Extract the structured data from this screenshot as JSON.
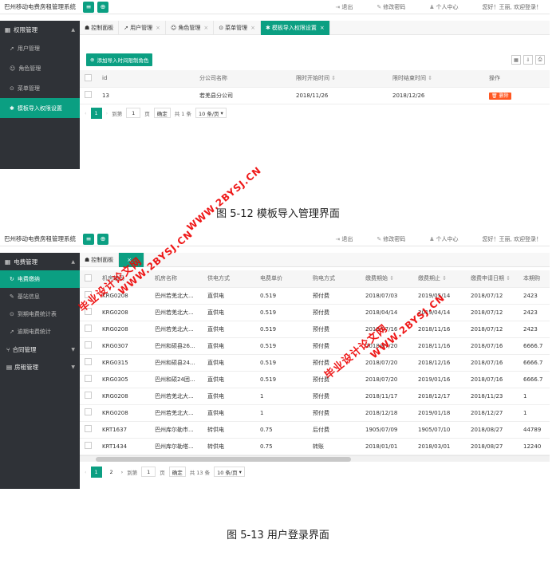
{
  "s1": {
    "title": "巴州移动电费房租管理系统",
    "top_links": [
      {
        "icon": "logout-icon",
        "glyph": "⇥",
        "label": "退出"
      },
      {
        "icon": "edit-icon",
        "glyph": "✎",
        "label": "修改密码"
      },
      {
        "icon": "user-icon",
        "glyph": "♟",
        "label": "个人中心"
      }
    ],
    "welcome": "您好！王丽, 欢迎登录！",
    "side_head": "权限管理",
    "side_items": [
      {
        "icon": "send-icon",
        "glyph": "➚",
        "label": "用户管理"
      },
      {
        "icon": "smile-icon",
        "glyph": "☺",
        "label": "角色管理"
      },
      {
        "icon": "menu-icon",
        "glyph": "⊙",
        "label": "菜单管理"
      },
      {
        "icon": "gear-icon",
        "glyph": "✱",
        "label": "模板导入权限设置"
      }
    ],
    "tabs": [
      {
        "glyph": "☗",
        "label": "控制面板"
      },
      {
        "glyph": "➚",
        "label": "用户管理"
      },
      {
        "glyph": "☺",
        "label": "角色管理"
      },
      {
        "glyph": "⊙",
        "label": "菜单管理"
      },
      {
        "glyph": "✱",
        "label": "模板导入权限设置"
      }
    ],
    "add_button": "添加导入时间限制角色",
    "columns": [
      "id",
      "分公司名称",
      "限时开始时间",
      "限时结束时间",
      "操作"
    ],
    "rows": [
      [
        "13",
        "若羌县分公司",
        "2018/11/26",
        "2018/12/26"
      ]
    ],
    "delete_label": "删除",
    "pager": {
      "page": "1",
      "goto": "到第",
      "unit": "页",
      "confirm": "确定",
      "total": "共 1 条",
      "per_page": "10 条/页"
    }
  },
  "caption1": "图 5-12   模板导入管理界面",
  "s2": {
    "title": "巴州移动电费房租管理系统",
    "side_head": "电费管理",
    "side_items": [
      {
        "label": "电费缴纳",
        "active": true
      },
      {
        "label": "基站信息",
        "active": false
      },
      {
        "label": "到期电费统计表",
        "active": false
      },
      {
        "label": "逾期电费统计",
        "active": false
      }
    ],
    "side_groups": [
      "合同管理",
      "房租管理"
    ],
    "tab_home": "控制面板",
    "columns": [
      "机房编码",
      "机房名称",
      "供电方式",
      "电费单价",
      "购电方式",
      "缴费期始",
      "缴费期止",
      "缴费申请日期",
      "本期购"
    ],
    "rows": [
      [
        "KRG0208",
        "巴州若羌北大...",
        "直供电",
        "0.519",
        "预付费",
        "2018/07/03",
        "2019/05/14",
        "2018/07/12",
        "2423"
      ],
      [
        "KRG0208",
        "巴州若羌北大...",
        "直供电",
        "0.519",
        "预付费",
        "2018/04/14",
        "2019/04/14",
        "2018/07/12",
        "2423"
      ],
      [
        "KRG0208",
        "巴州若羌北大...",
        "直供电",
        "0.519",
        "预付费",
        "2018/07/16",
        "2018/11/16",
        "2018/07/12",
        "2423"
      ],
      [
        "KRG0307",
        "巴州和硕县26...",
        "直供电",
        "0.519",
        "预付费",
        "2018/07/20",
        "2018/11/16",
        "2018/07/16",
        "6666.7"
      ],
      [
        "KRG0315",
        "巴州和硕县24...",
        "直供电",
        "0.519",
        "预付费",
        "2018/07/20",
        "2018/12/16",
        "2018/07/16",
        "6666.7"
      ],
      [
        "KRG0305",
        "巴州和硕24团...",
        "直供电",
        "0.519",
        "预付费",
        "2018/07/20",
        "2019/01/16",
        "2018/07/16",
        "6666.7"
      ],
      [
        "KRG0208",
        "巴州若羌北大...",
        "直供电",
        "1",
        "预付费",
        "2018/11/17",
        "2018/12/17",
        "2018/11/23",
        "1"
      ],
      [
        "KRG0208",
        "巴州若羌北大...",
        "直供电",
        "1",
        "预付费",
        "2018/12/18",
        "2019/01/18",
        "2018/12/27",
        "1"
      ],
      [
        "KRT1637",
        "巴州库尔勒市...",
        "转供电",
        "0.75",
        "后付费",
        "1905/07/09",
        "1905/07/10",
        "2018/08/27",
        "44789"
      ],
      [
        "KRT1434",
        "巴州库尔勒塔...",
        "转供电",
        "0.75",
        "转账",
        "2018/01/01",
        "2018/03/01",
        "2018/08/27",
        "12240"
      ]
    ],
    "pager": {
      "page": "1",
      "page2": "2",
      "goto": "到第",
      "goto_val": "1",
      "unit": "页",
      "confirm": "确定",
      "total": "共 13 条",
      "per_page": "10 条/页"
    }
  },
  "caption2": "图 5-13   用户登录界面",
  "watermarks": [
    "WWW.2BYSJ.CN",
    "毕业设计论文网",
    "WWW.2BYSJ.CN",
    "毕业设计论文网",
    "WWW.2BYSJ.CN"
  ],
  "colors": {
    "accent": "#0b9f82",
    "sidebar": "#2f3237",
    "danger": "#ff5722",
    "watermark": "#e00000"
  }
}
